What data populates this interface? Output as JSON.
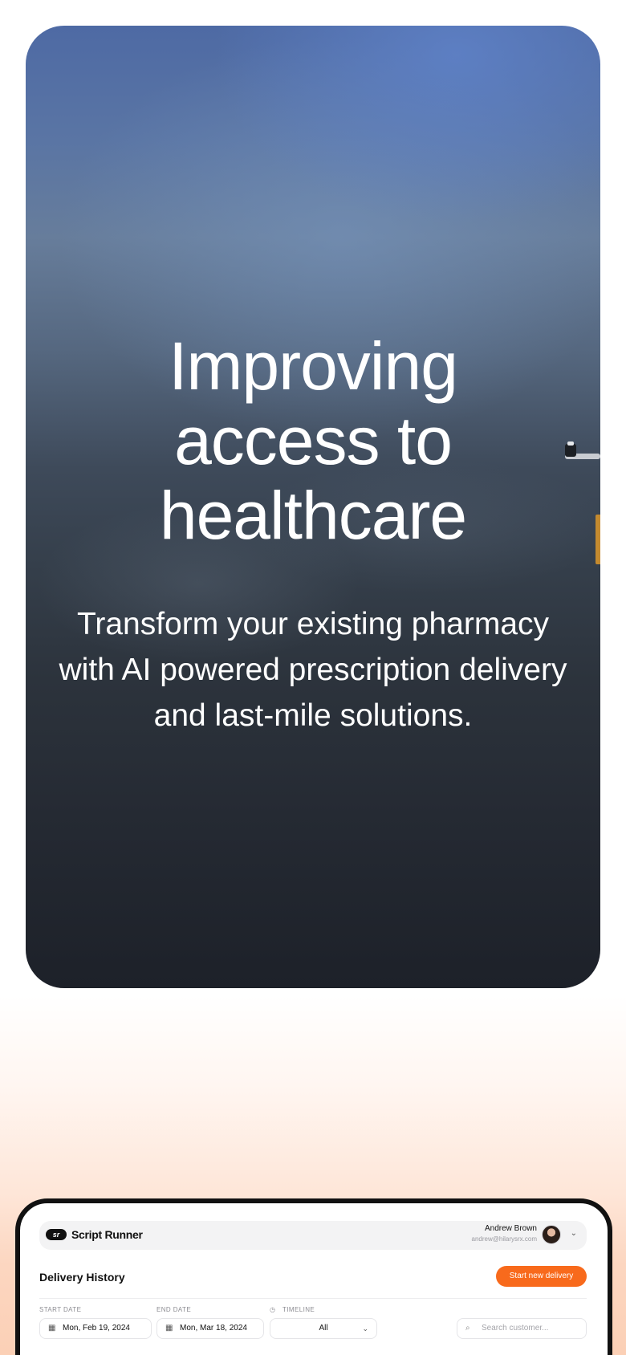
{
  "hero": {
    "title": "Improving access to healthcare",
    "subtitle": "Transform your existing pharmacy with AI powered prescription delivery and last-mile solutions."
  },
  "app": {
    "logo_badge": "sr",
    "logo_text": "Script Runner",
    "user": {
      "name": "Andrew Brown",
      "email": "andrew@hilarysrx.com"
    },
    "section_title": "Delivery History",
    "cta_label": "Start new delivery",
    "filters": {
      "start_date_label": "START DATE",
      "start_date_value": "Mon, Feb 19, 2024",
      "end_date_label": "END DATE",
      "end_date_value": "Mon, Mar 18, 2024",
      "timeline_label": "TIMELINE",
      "timeline_value": "All",
      "search_placeholder": "Search customer..."
    }
  },
  "colors": {
    "accent": "#f86a1c",
    "hero_top": "#4e6aa4",
    "hero_bottom": "#1d2129"
  },
  "icons": {
    "calendar": "calendar-icon",
    "clock": "clock-icon",
    "search": "search-icon",
    "chevron": "chevron-down-icon"
  }
}
